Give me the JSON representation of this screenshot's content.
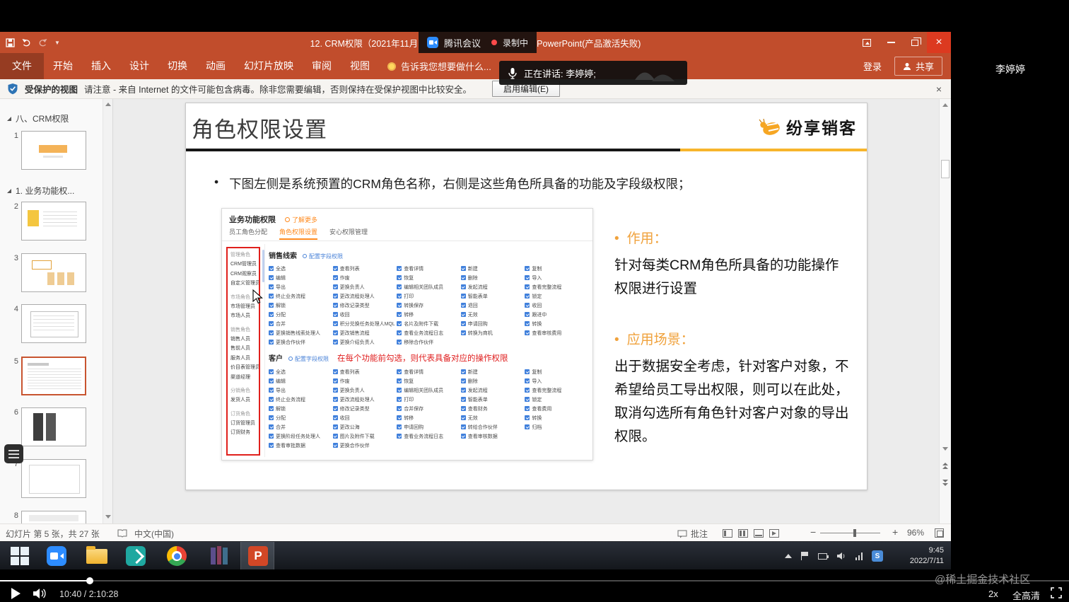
{
  "player": {
    "watermark": "@稀土掘金技术社区",
    "time_display": "10:40 / 2:10:28",
    "speed": "2x",
    "quality": "全高清"
  },
  "meeting": {
    "app_name": "腾讯会议",
    "recording": "录制中",
    "speaking": "正在讲话: 李婷婷;",
    "participant": "李婷婷"
  },
  "titlebar": {
    "title_left": "12. CRM权限（2021年11月",
    "title_right": "PowerPoint(产品激活失败)"
  },
  "ribbon": {
    "tabs": [
      "文件",
      "开始",
      "插入",
      "设计",
      "切换",
      "动画",
      "幻灯片放映",
      "审阅",
      "视图"
    ],
    "tell_me": "告诉我您想要做什么...",
    "sign_in": "登录",
    "share": "共享"
  },
  "protected_view": {
    "label": "受保护的视图",
    "message": "请注意 - 来自 Internet 的文件可能包含病毒。除非您需要编辑，否则保持在受保护视图中比较安全。",
    "enable_button": "启用编辑(E)"
  },
  "slide_panel": {
    "section1": "八、CRM权限",
    "section2": "1. 业务功能权...",
    "slides": [
      "1",
      "2",
      "3",
      "4",
      "5",
      "6",
      "7",
      "8"
    ],
    "selected_index": 4
  },
  "slide": {
    "title": "角色权限设置",
    "logo_text": "纷享销客",
    "bullet_marker": "•",
    "bullet": "下图左侧是系统预置的CRM角色名称，右侧是这些角色所具备的功能及字段级权限；",
    "right_column": {
      "marker": "•",
      "heading1": "作用：",
      "body1": "针对每类CRM角色所具备的功能操作权限进行设置",
      "heading2": "应用场景：",
      "body2": "出于数据安全考虑，针对客户对象，不希望给员工导出权限，则可以在此处，取消勾选所有角色针对客户对象的导出权限。"
    },
    "screenshot": {
      "header": "业务功能权限",
      "more_link": "了解更多",
      "tabs": [
        "员工角色分配",
        "角色权限设置",
        "安心权限管理"
      ],
      "annotation": "在每个功能前勾选，则代表具备对应的操作权限",
      "roles": [
        {
          "group": "管理角色",
          "items": [
            "CRM管理员",
            "CRM观察员",
            "自定义管理员"
          ]
        },
        {
          "group": "市场角色",
          "items": [
            "市场管理员",
            "市场人员"
          ]
        },
        {
          "group": "销售角色",
          "items": [
            "销售人员",
            "售前人员",
            "服务人员",
            "价目表管理员",
            "渠道经理"
          ]
        },
        {
          "group": "分销角色",
          "items": [
            "发货人员"
          ]
        },
        {
          "group": "订货角色",
          "items": [
            "订货管理员",
            "订货财务"
          ]
        }
      ],
      "sections": [
        {
          "name": "销售线索",
          "link": "配置字段权限",
          "rows": [
            [
              "全选",
              "查看列表",
              "查看详情",
              "新建",
              "复制"
            ],
            [
              "编辑",
              "作废",
              "恢复",
              "删除",
              "导入"
            ],
            [
              "导出",
              "更换负责人",
              "编辑相关团队成员",
              "发起流程",
              "查看完整流程"
            ],
            [
              "终止业务流程",
              "更改流程处理人",
              "打印",
              "智能表单",
              "锁定"
            ],
            [
              "解锁",
              "修改记录类型",
              "转换保存",
              "退回",
              "收回"
            ],
            [
              "分配",
              "收回",
              "转移",
              "无效",
              "跟进中"
            ],
            [
              "合并",
              "积分兑换任务处理人MQL",
              "名片及附件下载",
              "申请回购",
              "转换"
            ],
            [
              "更换销售线索处理人",
              "更改销售流程",
              "查看业务流程日志",
              "转换为商机",
              "查看审核费用"
            ],
            [
              "更换合作伙伴",
              "更换介绍负责人",
              "移除合作伙伴",
              "",
              ""
            ]
          ]
        },
        {
          "name": "客户",
          "link": "配置字段权限",
          "rows": [
            [
              "全选",
              "查看列表",
              "查看详情",
              "新建",
              "复制"
            ],
            [
              "编辑",
              "作废",
              "恢复",
              "删除",
              "导入"
            ],
            [
              "导出",
              "更换负责人",
              "编辑相关团队成员",
              "发起流程",
              "查看完整流程"
            ],
            [
              "终止业务流程",
              "更改流程处理人",
              "打印",
              "智能表单",
              "锁定"
            ],
            [
              "解锁",
              "修改记录类型",
              "合并保存",
              "查看财务",
              "查看费用"
            ],
            [
              "分配",
              "收回",
              "转移",
              "无效",
              "转换"
            ],
            [
              "合并",
              "更改公海",
              "申请回购",
              "转给合作伙伴",
              "归档"
            ],
            [
              "更换阶段任务处理人",
              "图片及附件下载",
              "查看业务流程日志",
              "查看审核数据",
              ""
            ],
            [
              "查看审批数据",
              "更换合作伙伴",
              "",
              "",
              ""
            ]
          ]
        }
      ]
    }
  },
  "status_bar": {
    "slide_info": "幻灯片 第 5 张，共 27 张",
    "language": "中文(中国)",
    "notes_label": "批注",
    "zoom_level": "96%"
  },
  "taskbar": {
    "time": "9:45",
    "date": "2022/7/11"
  }
}
